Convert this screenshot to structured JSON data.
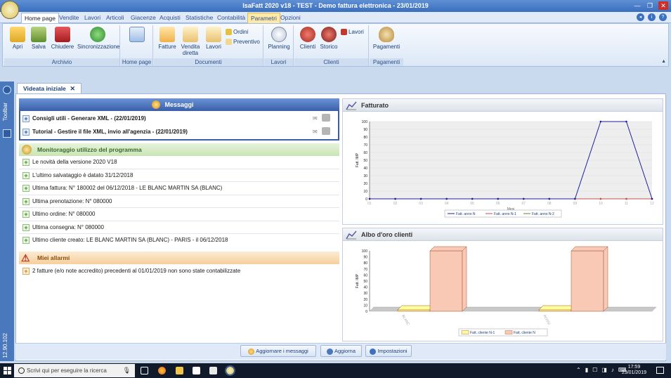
{
  "window": {
    "title": "IsaFatt 2020 v18 - TEST - Demo fattura elettronica - 23/01/2019"
  },
  "ribbon_tabs": [
    {
      "label": "Home page"
    },
    {
      "label": "Vendite"
    },
    {
      "label": "Lavori"
    },
    {
      "label": "Articoli"
    },
    {
      "label": "Giacenze"
    },
    {
      "label": "Acquisti"
    },
    {
      "label": "Statistiche"
    },
    {
      "label": "Contabilità"
    },
    {
      "label": "Parametri"
    },
    {
      "label": "Opzioni"
    }
  ],
  "ribbon": {
    "archivio": {
      "label": "Archivio",
      "apri": "Apri",
      "salva": "Salva",
      "chiudere": "Chiudere",
      "sincronizzazione": "Sincronizzazione"
    },
    "homepage": {
      "label": "Home page"
    },
    "documenti": {
      "label": "Documenti",
      "fatture": "Fatture",
      "vendita_diretta": "Vendita diretta",
      "lavori": "Lavori",
      "ordini": "Ordini",
      "preventivo": "Preventivo"
    },
    "lavori": {
      "label": "Lavori",
      "planning": "Planning"
    },
    "clienti": {
      "label": "Clienti",
      "clienti": "Clienti",
      "storico": "Storico",
      "lavori": "Lavori"
    },
    "pagamenti": {
      "label": "Pagamenti",
      "pagamenti": "Pagamenti"
    }
  },
  "sidebar": {
    "toolbar": "Toolbar",
    "version": "12.90.102"
  },
  "doc_tab": {
    "label": "Videata iniziale",
    "close": "✕"
  },
  "messages": {
    "title": "Messaggi",
    "items": [
      "Consigli utili - Generare XML - (22/01/2019)",
      "Tutorial - Gestire il file XML, invio all'agenzia - (22/01/2019)"
    ]
  },
  "monitoring": {
    "title": "Monitoraggio utilizzo del programma",
    "items": [
      "Le novità della versione 2020 V18",
      "L'ultimo salvataggio è datato 31/12/2018",
      "Ultima fattura: N° 180002 del 06/12/2018 - LE BLANC MARTIN SA (BLANC)",
      "Ultima prenotazione: N° 080000",
      "Ultimo ordine: N° 080000",
      "Ultima consegna: N° 080000",
      "Ultimo cliente creato: LE BLANC MARTIN SA (BLANC) -  PARIS - il 06/12/2018"
    ]
  },
  "alarms": {
    "title": "Miei allarmi",
    "items": [
      "2 fatture (e/o note accredito) precedenti al 01/01/2019 non sono state contabilizzate"
    ]
  },
  "chart_data": [
    {
      "type": "line",
      "title": "Fatturato",
      "ylabel": "Fatt. IMP",
      "xlabel": "Mesi",
      "x": [
        "01",
        "02",
        "03",
        "04",
        "05",
        "06",
        "07",
        "08",
        "09",
        "10",
        "11",
        "12"
      ],
      "ylim": [
        0,
        100
      ],
      "yticks": [
        "0",
        "10",
        "20",
        "30",
        "40",
        "50",
        "60",
        "70",
        "80",
        "90",
        "100"
      ],
      "series": [
        {
          "name": "Fatt. anno N",
          "values": [
            0,
            0,
            0,
            0,
            0,
            0,
            0,
            0,
            0,
            100,
            100,
            0
          ],
          "color": "#1f1f9e"
        },
        {
          "name": "Fatt. anno N-1",
          "values": [
            0,
            0,
            0,
            0,
            0,
            0,
            0,
            0,
            0,
            0,
            0,
            0
          ],
          "color": "#c0504d"
        },
        {
          "name": "Fatt. anno N-2",
          "values": [
            0,
            0,
            0,
            0,
            0,
            0,
            0,
            0,
            0,
            0,
            0,
            0
          ],
          "color": "#4f8a3c"
        }
      ],
      "legend": "bottom"
    },
    {
      "type": "bar",
      "title": "Albo d'oro clienti",
      "ylabel": "Fatt. IMP",
      "categories": [
        "BLANC",
        "ROSSI"
      ],
      "ylim": [
        0,
        100
      ],
      "yticks": [
        "0",
        "10",
        "20",
        "30",
        "40",
        "50",
        "60",
        "70",
        "80",
        "90",
        "100"
      ],
      "series": [
        {
          "name": "Fatt. cliente N-1",
          "values": [
            0,
            0
          ],
          "color": "#ffff99"
        },
        {
          "name": "Fatt. cliente N",
          "values": [
            100,
            100
          ],
          "color": "#f9c9b6"
        }
      ],
      "legend": "bottom"
    }
  ],
  "bottom_buttons": {
    "aggiornare": "Aggiornare i messaggi",
    "aggiorna": "Aggiorna",
    "impostazioni": "Impostazioni"
  },
  "taskbar": {
    "search_placeholder": "Scrivi qui per eseguire la ricerca",
    "time": "17:59",
    "date": "23/01/2019"
  }
}
